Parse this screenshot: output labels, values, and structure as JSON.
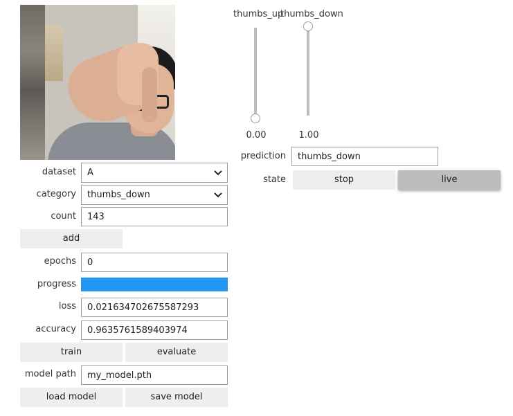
{
  "camera": {
    "alt": "webcam image"
  },
  "sliders": [
    {
      "label": "thumbs_up",
      "value_text": "0.00",
      "value": 0.0
    },
    {
      "label": "thumbs_down",
      "value_text": "1.00",
      "value": 1.0
    }
  ],
  "prediction": {
    "label": "prediction",
    "value": "thumbs_down"
  },
  "state": {
    "label": "state",
    "options": [
      "stop",
      "live"
    ],
    "selected": "live"
  },
  "dataset": {
    "label": "dataset",
    "value": "A"
  },
  "category": {
    "label": "category",
    "value": "thumbs_down"
  },
  "count": {
    "label": "count",
    "value": "143"
  },
  "add_button": "add",
  "epochs": {
    "label": "epochs",
    "value": "0"
  },
  "progress": {
    "label": "progress",
    "value": 1.0,
    "color": "#2196f3"
  },
  "loss": {
    "label": "loss",
    "value": "0.021634702675587293"
  },
  "accuracy": {
    "label": "accuracy",
    "value": "0.9635761589403974"
  },
  "train_button": "train",
  "evaluate_button": "evaluate",
  "model_path": {
    "label": "model path",
    "value": "my_model.pth"
  },
  "load_model_button": "load model",
  "save_model_button": "save model",
  "colors": {
    "button_bg": "#eeeeee",
    "active_button_bg": "#bdbdbd",
    "border": "#9e9e9e"
  }
}
